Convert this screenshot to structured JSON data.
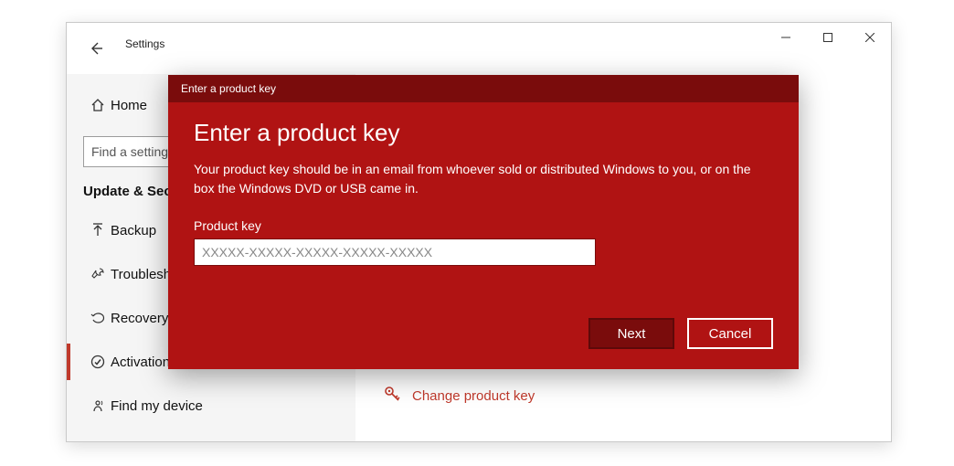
{
  "window": {
    "title": "Settings",
    "search_placeholder": "Find a setting",
    "home_label": "Home",
    "section_header": "Update & Security",
    "nav": [
      {
        "label": "Backup"
      },
      {
        "label": "Troubleshoot"
      },
      {
        "label": "Recovery"
      },
      {
        "label": "Activation"
      },
      {
        "label": "Find my device"
      }
    ],
    "active_nav_index": 3
  },
  "content": {
    "change_key_link": "Change product key"
  },
  "dialog": {
    "titlebar": "Enter a product key",
    "heading": "Enter a product key",
    "description": "Your product key should be in an email from whoever sold or distributed Windows to you, or on the box the Windows DVD or USB came in.",
    "field_label": "Product key",
    "input_placeholder": "XXXXX-XXXXX-XXXXX-XXXXX-XXXXX",
    "input_value": "",
    "next_label": "Next",
    "cancel_label": "Cancel"
  },
  "colors": {
    "accent": "#c0392b",
    "dialog_bg": "#b01313",
    "dialog_dark": "#7a0c0c"
  }
}
